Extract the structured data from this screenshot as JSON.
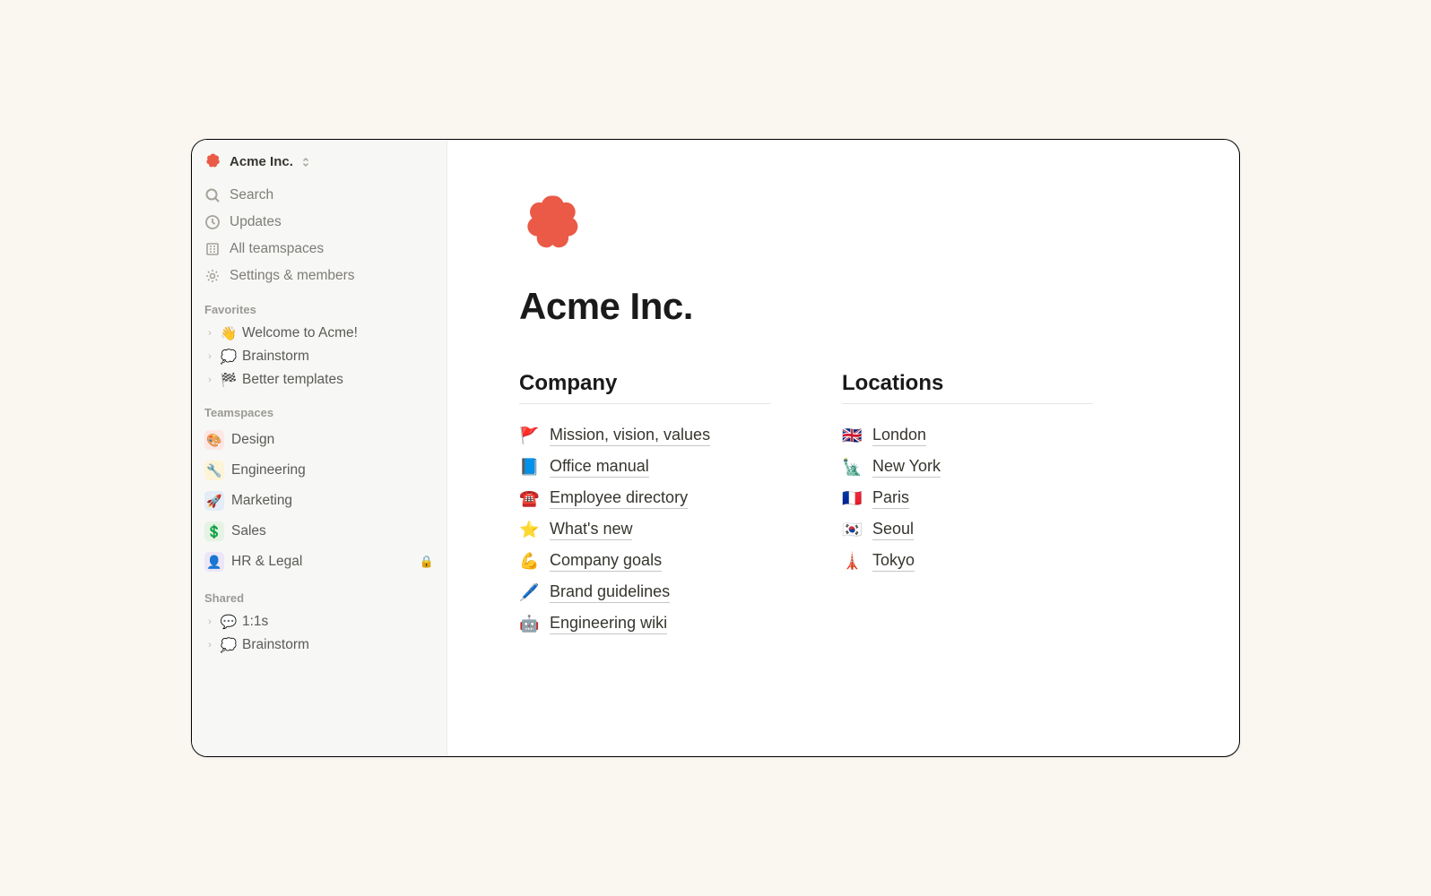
{
  "workspace": {
    "name": "Acme Inc."
  },
  "sidebar": {
    "nav": {
      "search": "Search",
      "updates": "Updates",
      "all_teamspaces": "All teamspaces",
      "settings": "Settings & members"
    },
    "sections": {
      "favorites": "Favorites",
      "teamspaces": "Teamspaces",
      "shared": "Shared"
    },
    "favorites": [
      {
        "emoji": "👋",
        "label": "Welcome to Acme!"
      },
      {
        "emoji": "💭",
        "label": "Brainstorm"
      },
      {
        "emoji": "🏁",
        "label": "Better templates"
      }
    ],
    "teamspaces": [
      {
        "emoji": "🎨",
        "bg": "#fde7e5",
        "label": "Design",
        "locked": false
      },
      {
        "emoji": "🔧",
        "bg": "#fdf3d7",
        "label": "Engineering",
        "locked": false
      },
      {
        "emoji": "🚀",
        "bg": "#e3ecf7",
        "label": "Marketing",
        "locked": false
      },
      {
        "emoji": "💲",
        "bg": "#e5f3e5",
        "label": "Sales",
        "locked": false
      },
      {
        "emoji": "👤",
        "bg": "#ece6f7",
        "label": "HR & Legal",
        "locked": true
      }
    ],
    "shared": [
      {
        "emoji": "💬",
        "label": "1:1s"
      },
      {
        "emoji": "💭",
        "label": "Brainstorm"
      }
    ]
  },
  "page": {
    "title": "Acme Inc.",
    "columns": {
      "company": {
        "heading": "Company",
        "items": [
          {
            "emoji": "🚩",
            "label": "Mission, vision, values"
          },
          {
            "emoji": "📘",
            "label": "Office manual"
          },
          {
            "emoji": "☎️",
            "label": "Employee directory"
          },
          {
            "emoji": "⭐",
            "label": "What's new"
          },
          {
            "emoji": "💪",
            "label": "Company goals"
          },
          {
            "emoji": "🖊️",
            "label": "Brand guidelines"
          },
          {
            "emoji": "🤖",
            "label": "Engineering wiki"
          }
        ]
      },
      "locations": {
        "heading": "Locations",
        "items": [
          {
            "emoji": "🇬🇧",
            "label": "London"
          },
          {
            "emoji": "🗽",
            "label": "New York"
          },
          {
            "emoji": "🇫🇷",
            "label": "Paris"
          },
          {
            "emoji": "🇰🇷",
            "label": "Seoul"
          },
          {
            "emoji": "🗼",
            "label": "Tokyo"
          }
        ]
      }
    }
  }
}
